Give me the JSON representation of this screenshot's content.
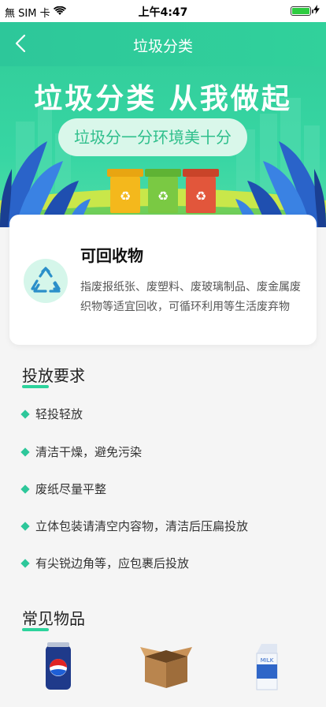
{
  "status_bar": {
    "carrier": "無 SIM 卡",
    "time": "上午4:47"
  },
  "nav": {
    "title": "垃圾分类"
  },
  "banner": {
    "headline": "垃圾分类 从我做起",
    "slogan": "垃圾分一分环境美十分"
  },
  "category": {
    "title": "可回收物",
    "description": "指废报纸张、废塑料、废玻璃制品、废金属废织物等适宜回收，可循环利用等生活废弃物"
  },
  "requirements": {
    "title": "投放要求",
    "items": [
      "轻投轻放",
      "清洁干燥，避免污染",
      "废纸尽量平整",
      "立体包装请清空内容物，清洁后压扁投放",
      "有尖锐边角等，应包裹后投放"
    ]
  },
  "common_items": {
    "title": "常见物品",
    "items": [
      {
        "icon": "soda-can-icon"
      },
      {
        "icon": "cardboard-box-icon"
      },
      {
        "icon": "milk-carton-icon",
        "label": "MILK"
      }
    ]
  },
  "colors": {
    "accent": "#2dc79a",
    "bin_yellow": "#f4b81c",
    "bin_green": "#7ac943",
    "bin_red": "#e2563b"
  }
}
